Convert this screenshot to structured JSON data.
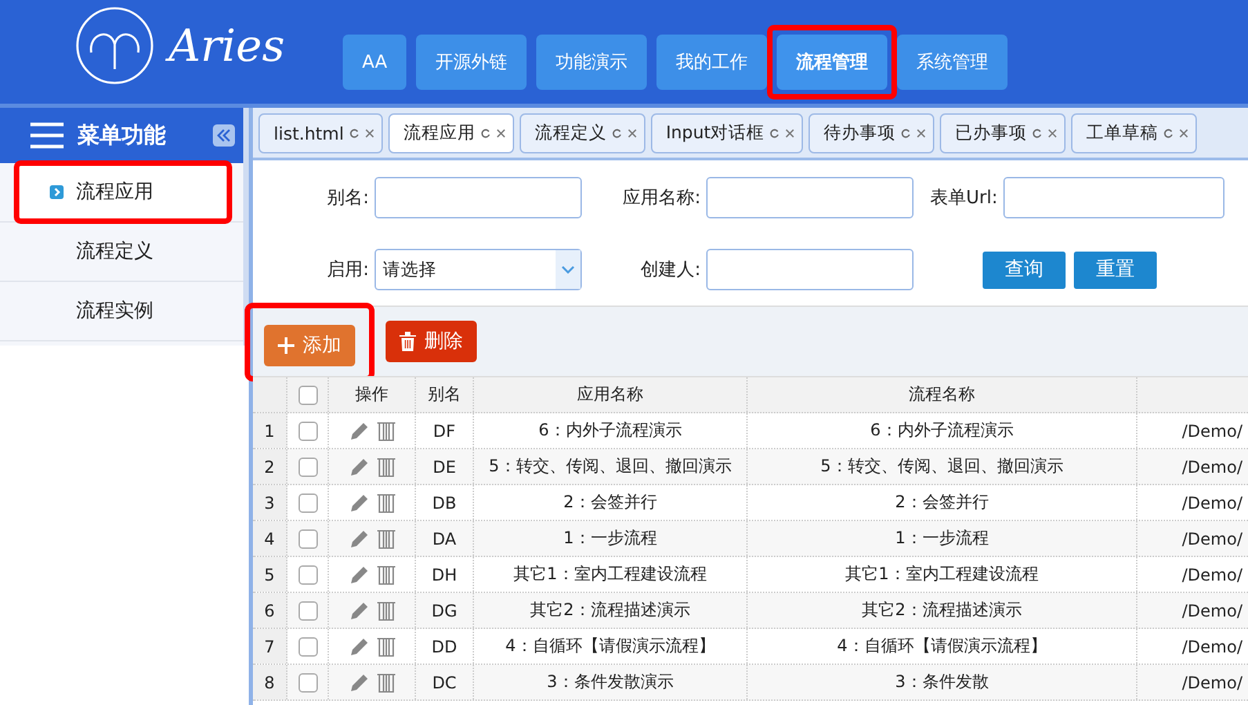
{
  "header": {
    "logo_text": "Aries",
    "nav": [
      {
        "label": "AA",
        "selected": false,
        "highlighted": false
      },
      {
        "label": "开源外链",
        "selected": false,
        "highlighted": false
      },
      {
        "label": "功能演示",
        "selected": false,
        "highlighted": false
      },
      {
        "label": "我的工作",
        "selected": false,
        "highlighted": false
      },
      {
        "label": "流程管理",
        "selected": true,
        "highlighted": true
      },
      {
        "label": "系统管理",
        "selected": false,
        "highlighted": false
      }
    ]
  },
  "sidebar": {
    "title": "菜单功能",
    "items": [
      {
        "label": "流程应用",
        "selected": true,
        "highlighted": true
      },
      {
        "label": "流程定义",
        "selected": false,
        "highlighted": false
      },
      {
        "label": "流程实例",
        "selected": false,
        "highlighted": false
      }
    ]
  },
  "tabs": [
    {
      "label": "list.html",
      "selected": false
    },
    {
      "label": "流程应用",
      "selected": true
    },
    {
      "label": "流程定义",
      "selected": false
    },
    {
      "label": "Input对话框",
      "selected": false
    },
    {
      "label": "待办事项",
      "selected": false
    },
    {
      "label": "已办事项",
      "selected": false
    },
    {
      "label": "工单草稿",
      "selected": false
    }
  ],
  "filters": [
    {
      "kind": "text",
      "label": "别名:"
    },
    {
      "kind": "text",
      "label": "应用名称:"
    },
    {
      "kind": "text",
      "label": "表单Url:"
    },
    {
      "kind": "select",
      "label": "启用:",
      "value": "请选择"
    },
    {
      "kind": "text",
      "label": "创建人:"
    }
  ],
  "filter_buttons": [
    "查询",
    "重置"
  ],
  "toolbar": [
    {
      "kind": "add",
      "label": "添加",
      "highlighted": true
    },
    {
      "kind": "delete",
      "label": "删除",
      "highlighted": false
    }
  ],
  "table": {
    "select_all_checked": false,
    "columns": [
      "操作",
      "别名",
      "应用名称",
      "流程名称"
    ],
    "rows": [
      {
        "index": "1",
        "checked": false,
        "alias": "DF",
        "app_name": "6：内外子流程演示",
        "flow_name": "6：内外子流程演示",
        "column_7": "/Demo/"
      },
      {
        "index": "2",
        "checked": false,
        "alias": "DE",
        "app_name": "5：转交、传阅、退回、撤回演示",
        "flow_name": "5：转交、传阅、退回、撤回演示",
        "column_7": "/Demo/"
      },
      {
        "index": "3",
        "checked": false,
        "alias": "DB",
        "app_name": "2：会签并行",
        "flow_name": "2：会签并行",
        "column_7": "/Demo/"
      },
      {
        "index": "4",
        "checked": false,
        "alias": "DA",
        "app_name": "1：一步流程",
        "flow_name": "1：一步流程",
        "column_7": "/Demo/"
      },
      {
        "index": "5",
        "checked": false,
        "alias": "DH",
        "app_name": "其它1：室内工程建设流程",
        "flow_name": "其它1：室内工程建设流程",
        "column_7": "/Demo/"
      },
      {
        "index": "6",
        "checked": false,
        "alias": "DG",
        "app_name": "其它2：流程描述演示",
        "flow_name": "其它2：流程描述演示",
        "column_7": "/Demo/"
      },
      {
        "index": "7",
        "checked": false,
        "alias": "DD",
        "app_name": "4：自循环【请假演示流程】",
        "flow_name": "4：自循环【请假演示流程】",
        "column_7": "/Demo/"
      },
      {
        "index": "8",
        "checked": false,
        "alias": "DC",
        "app_name": "3：条件发散演示",
        "flow_name": "3：条件发散",
        "column_7": "/Demo/"
      }
    ]
  }
}
